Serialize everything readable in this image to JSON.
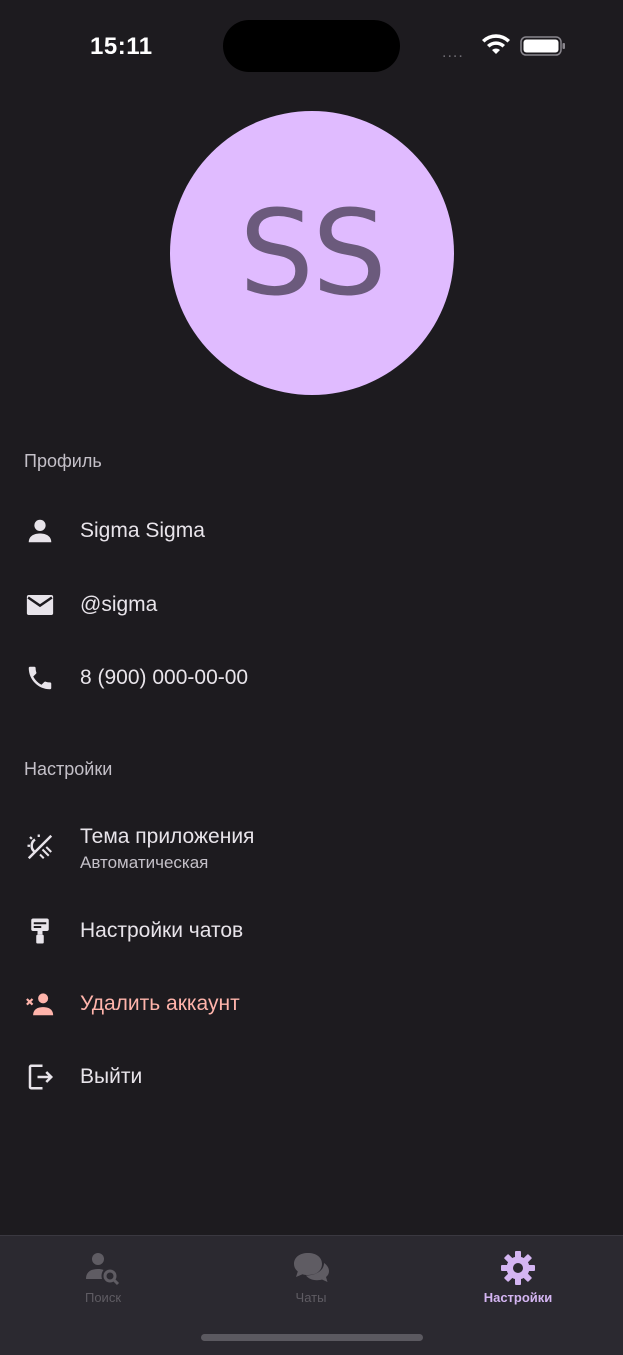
{
  "status": {
    "time": "15:11",
    "dots": "...."
  },
  "avatar": {
    "initials": "SS",
    "bg": "#e0bbff"
  },
  "profile": {
    "header": "Профиль",
    "name": "Sigma Sigma",
    "username": "@sigma",
    "phone": "8 (900) 000-00-00"
  },
  "settings": {
    "header": "Настройки",
    "theme_label": "Тема приложения",
    "theme_value": "Автоматическая",
    "chat_settings": "Настройки чатов",
    "delete_account": "Удалить аккаунт",
    "logout": "Выйти"
  },
  "nav": {
    "items": [
      {
        "label": "Поиск",
        "icon": "person-search-icon",
        "active": false
      },
      {
        "label": "Чаты",
        "icon": "chat-bubbles-icon",
        "active": false
      },
      {
        "label": "Настройки",
        "icon": "gear-icon",
        "active": true
      }
    ]
  },
  "colors": {
    "background": "#1d1b1f",
    "accent": "#d4b5f2",
    "danger": "#ffb4ab",
    "nav_bg": "#2b2930"
  }
}
